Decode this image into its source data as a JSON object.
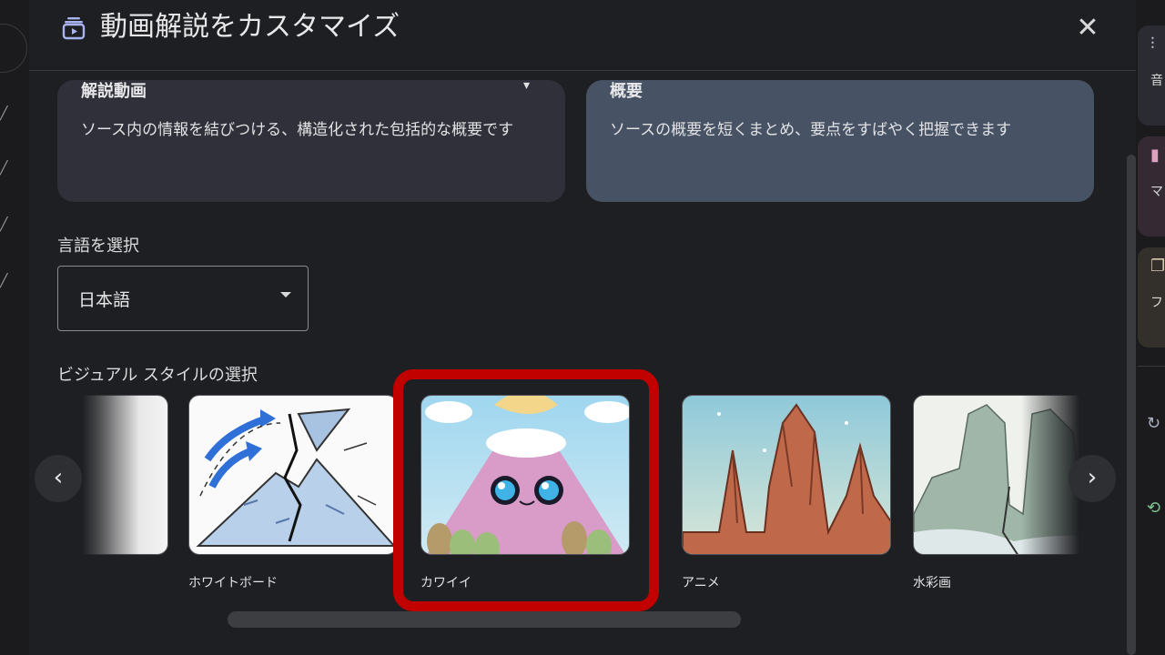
{
  "dialog": {
    "title": "動画解説をカスタマイズ",
    "close_label": "✕"
  },
  "format_cards": [
    {
      "title": "解説動画",
      "description": "ソース内の情報を結びつける、構造化された包括的な概要です",
      "selected": false
    },
    {
      "title": "概要",
      "description": "ソースの概要を短くまとめ、要点をすばやく把握できます",
      "selected": true
    }
  ],
  "language": {
    "label": "言語を選択",
    "value": "日本語"
  },
  "visual_style": {
    "label": "ビジュアル スタイルの選択",
    "styles": [
      {
        "name": "",
        "icon": "gradient-thumbnail"
      },
      {
        "name": "ホワイトボード",
        "icon": "whiteboard-volcano-thumbnail"
      },
      {
        "name": "カワイイ",
        "icon": "kawaii-volcano-thumbnail",
        "highlighted": true
      },
      {
        "name": "アニメ",
        "icon": "anime-rocks-thumbnail"
      },
      {
        "name": "水彩画",
        "icon": "watercolor-cliffs-thumbnail"
      }
    ],
    "prev_label": "‹",
    "next_label": "›"
  },
  "side_panel": {
    "items": [
      {
        "label": "音",
        "icon": "audio-wave-icon"
      },
      {
        "label": "マ",
        "icon": "mindmap-icon"
      },
      {
        "label": "フ",
        "icon": "flashcards-icon"
      }
    ]
  },
  "colors": {
    "highlight": "#c10000",
    "dialog_bg": "#1e1f22",
    "selected_card": "#475365"
  }
}
